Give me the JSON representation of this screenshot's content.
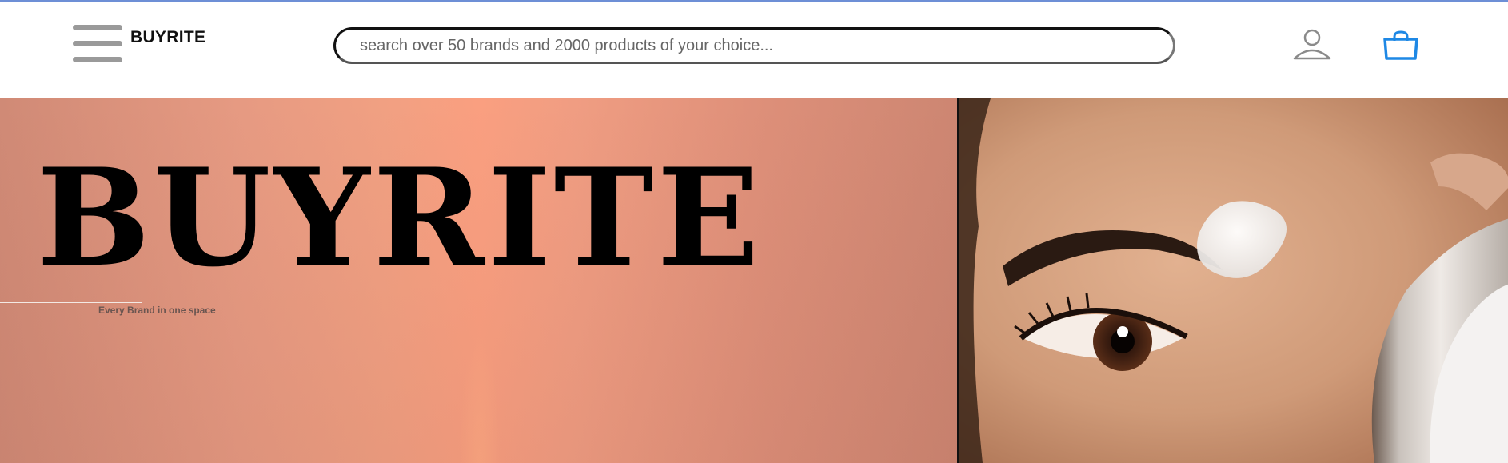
{
  "header": {
    "brand": "BUYRITE",
    "search": {
      "placeholder": "search over 50 brands and 2000 products of your choice...",
      "value": ""
    },
    "icons": [
      "menu-icon",
      "user-icon",
      "shopping-bag-icon"
    ],
    "colors": {
      "menu": "#9a9a9a",
      "user": "#8a8a8a",
      "cart": "#1e88e5"
    }
  },
  "hero": {
    "title": "BUYRITE",
    "tagline": "Every Brand in one space",
    "colors": {
      "background": "#e8977d",
      "title": "#000000"
    }
  }
}
